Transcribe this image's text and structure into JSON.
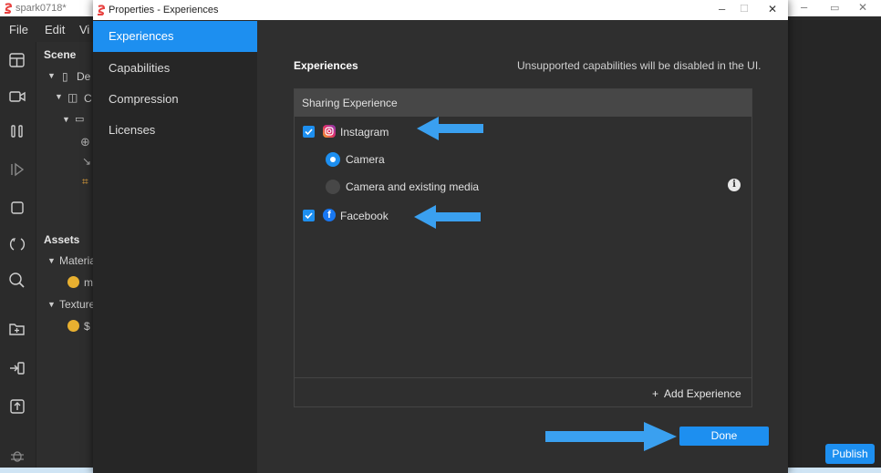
{
  "app": {
    "title": "spark0718*",
    "menu": [
      "File",
      "Edit",
      "Vi"
    ],
    "scene_heading": "Scene",
    "scene_items": [
      "De",
      "C",
      ""
    ],
    "assets_heading": "Assets",
    "asset_items": [
      "Materia",
      "m",
      "Texture",
      "$"
    ],
    "publish_label": "Publish"
  },
  "dialog": {
    "title": "Properties - Experiences",
    "sidebar": [
      {
        "label": "Experiences",
        "active": true
      },
      {
        "label": "Capabilities",
        "active": false
      },
      {
        "label": "Compression",
        "active": false
      },
      {
        "label": "Licenses",
        "active": false
      }
    ],
    "heading": "Experiences",
    "note": "Unsupported capabilities will be disabled in the UI.",
    "box_header": "Sharing Experience",
    "instagram_label": "Instagram",
    "camera_label": "Camera",
    "camera_media_label": "Camera and existing media",
    "facebook_label": "Facebook",
    "add_experience": "+  Add Experience",
    "done_label": "Done"
  },
  "colors": {
    "accent": "#1d8ff0",
    "arrow": "#3aa0f0"
  }
}
